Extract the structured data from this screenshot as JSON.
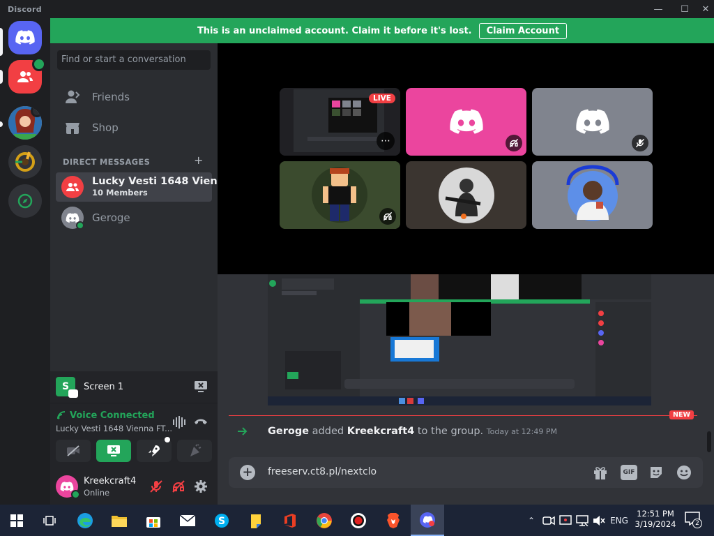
{
  "window": {
    "title": "Discord"
  },
  "banner": {
    "message": "This is an unclaimed account. Claim it before it's lost.",
    "claim_label": "Claim Account"
  },
  "sidebar": {
    "search_placeholder": "Find or start a conversation",
    "nav": [
      {
        "label": "Friends",
        "icon": "friends-icon"
      },
      {
        "label": "Shop",
        "icon": "shop-icon"
      }
    ],
    "dm_header": "DIRECT MESSAGES",
    "dms": [
      {
        "name": "Lucky Vesti 1648 Vien...",
        "sub": "10 Members",
        "selected": true
      },
      {
        "name": "Geroge",
        "sub": "",
        "selected": false
      }
    ]
  },
  "screen_panel": {
    "label": "Screen 1"
  },
  "voice_panel": {
    "status": "Voice Connected",
    "channel": "Lucky Vesti 1648 Vienna FT..."
  },
  "user_panel": {
    "name": "Kreekcraft4",
    "status": "Online"
  },
  "stage": {
    "live_badge": "LIVE"
  },
  "chat": {
    "new_badge": "NEW",
    "system_message": {
      "actor": "Geroge",
      "verb": "added",
      "target": "Kreekcraft4",
      "rest": "to the group.",
      "time": "Today at 12:49 PM"
    },
    "composer_value": "freeserv.ct8.pl/nextclo",
    "gif_label": "GIF"
  },
  "taskbar": {
    "time": "12:51 PM",
    "date": "3/19/2024",
    "lang": "ENG",
    "notif_count": "2"
  },
  "colors": {
    "blurple": "#5865f2",
    "green": "#23a55a",
    "red": "#f23f43",
    "pink": "#eb459e",
    "grey_tile": "#80848e"
  }
}
